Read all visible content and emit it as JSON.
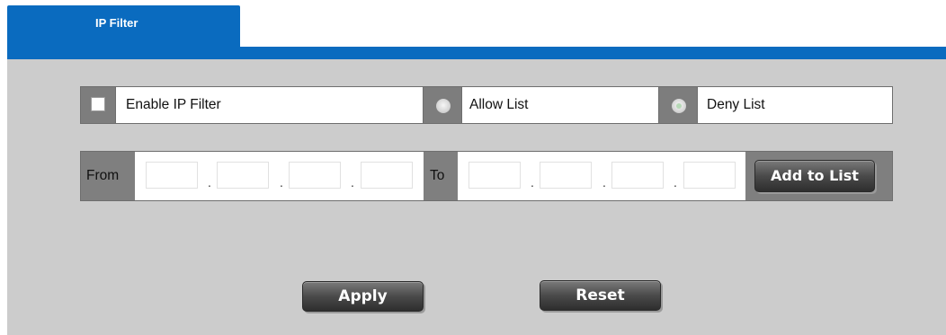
{
  "tab": {
    "label": "IP Filter"
  },
  "filter": {
    "enable_label": "Enable IP Filter",
    "allow_label": "Allow List",
    "deny_label": "Deny List",
    "selected_mode": "Deny List"
  },
  "range": {
    "from_label": "From",
    "to_label": "To",
    "separator": ".",
    "from_octets": [
      "",
      "",
      "",
      ""
    ],
    "to_octets": [
      "",
      "",
      "",
      ""
    ],
    "add_button": "Add to List"
  },
  "actions": {
    "apply": "Apply",
    "reset": "Reset"
  },
  "colors": {
    "accent": "#0a6bbf",
    "panel": "#cccccc",
    "button": "#4a4a4a"
  }
}
